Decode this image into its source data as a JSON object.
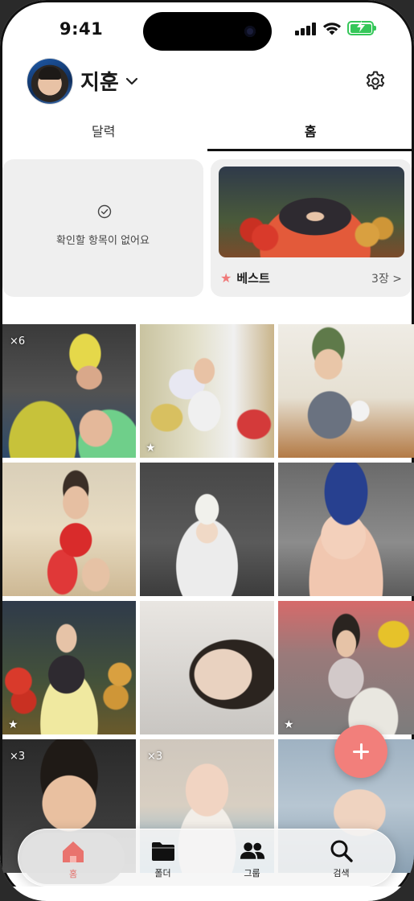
{
  "status_bar": {
    "time": "9:41"
  },
  "header": {
    "user_name": "지훈",
    "settings_icon": "gear-icon"
  },
  "tabs": [
    {
      "label": "달력",
      "active": false
    },
    {
      "label": "홈",
      "active": true
    }
  ],
  "review_card": {
    "message": "확인할 항목이 없어요"
  },
  "best_card": {
    "label": "베스트",
    "count": "3장 >"
  },
  "photos": [
    {
      "badge": "×6",
      "starred": false
    },
    {
      "badge": "",
      "starred": true
    },
    {
      "badge": "",
      "starred": false
    },
    {
      "badge": "",
      "starred": false
    },
    {
      "badge": "",
      "starred": false
    },
    {
      "badge": "",
      "starred": false
    },
    {
      "badge": "",
      "starred": true
    },
    {
      "badge": "",
      "starred": false
    },
    {
      "badge": "",
      "starred": true
    },
    {
      "badge": "×3",
      "starred": false
    },
    {
      "badge": "×3",
      "starred": false
    },
    {
      "badge": "",
      "starred": false
    }
  ],
  "nav": [
    {
      "label": "홈",
      "icon": "home-icon",
      "active": true
    },
    {
      "label": "폴더",
      "icon": "folder-icon",
      "active": false
    },
    {
      "label": "그룹",
      "icon": "group-icon",
      "active": false
    },
    {
      "label": "검색",
      "icon": "search-icon",
      "active": false
    }
  ],
  "colors": {
    "accent": "#f27f7b",
    "battery": "#35c759"
  }
}
